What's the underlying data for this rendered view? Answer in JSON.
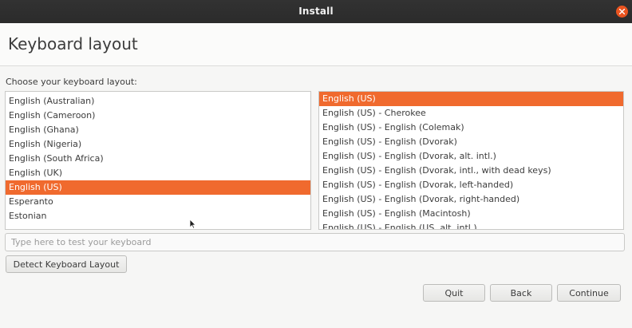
{
  "window": {
    "title": "Install",
    "close_icon": "close-icon"
  },
  "header": {
    "title": "Keyboard layout"
  },
  "prompt": "Choose your keyboard layout:",
  "layouts": {
    "items": [
      "English (Australian)",
      "English (Cameroon)",
      "English (Ghana)",
      "English (Nigeria)",
      "English (South Africa)",
      "English (UK)",
      "English (US)",
      "Esperanto",
      "Estonian"
    ],
    "selected": "English (US)"
  },
  "variants": {
    "items": [
      "English (US)",
      "English (US) - Cherokee",
      "English (US) - English (Colemak)",
      "English (US) - English (Dvorak)",
      "English (US) - English (Dvorak, alt. intl.)",
      "English (US) - English (Dvorak, intl., with dead keys)",
      "English (US) - English (Dvorak, left-handed)",
      "English (US) - English (Dvorak, right-handed)",
      "English (US) - English (Macintosh)",
      "English (US) - English (US, alt. intl.)"
    ],
    "selected": "English (US)"
  },
  "test_field": {
    "placeholder": "Type here to test your keyboard",
    "value": ""
  },
  "buttons": {
    "detect": "Detect Keyboard Layout",
    "quit": "Quit",
    "back": "Back",
    "continue": "Continue"
  },
  "colors": {
    "accent": "#f06a2e",
    "titlebar": "#2d2d2d",
    "close": "#e95420"
  }
}
